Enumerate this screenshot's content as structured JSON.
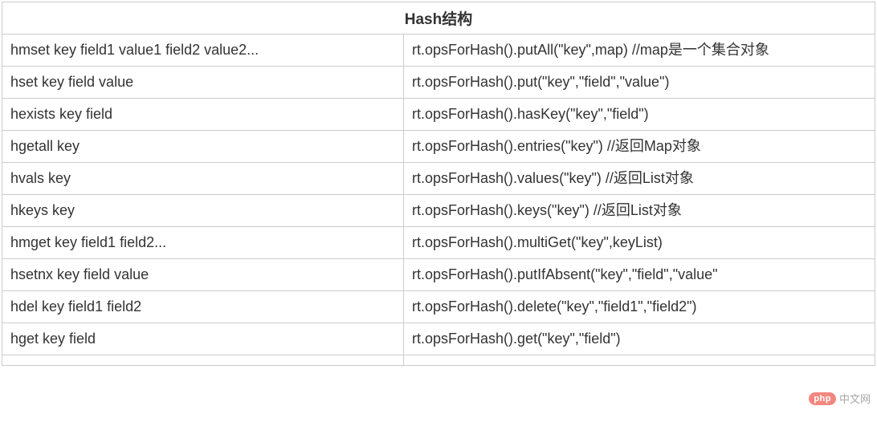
{
  "table": {
    "header": "Hash结构",
    "rows": [
      {
        "left": "hmset key field1 value1 field2 value2...",
        "right": "rt.opsForHash().putAll(\"key\",map) //map是一个集合对象"
      },
      {
        "left": "hset key field value",
        "right": "rt.opsForHash().put(\"key\",\"field\",\"value\")"
      },
      {
        "left": "hexists key field",
        "right": "rt.opsForHash().hasKey(\"key\",\"field\")"
      },
      {
        "left": "hgetall key",
        "right": "rt.opsForHash().entries(\"key\")  //返回Map对象"
      },
      {
        "left": "hvals key",
        "right": "rt.opsForHash().values(\"key\") //返回List对象"
      },
      {
        "left": "hkeys key",
        "right": "rt.opsForHash().keys(\"key\") //返回List对象"
      },
      {
        "left": "hmget key field1 field2...",
        "right": "rt.opsForHash().multiGet(\"key\",keyList)"
      },
      {
        "left": "hsetnx key field value",
        "right": "rt.opsForHash().putIfAbsent(\"key\",\"field\",\"value\""
      },
      {
        "left": "hdel key field1 field2",
        "right": "rt.opsForHash().delete(\"key\",\"field1\",\"field2\")"
      },
      {
        "left": "hget key field",
        "right": "rt.opsForHash().get(\"key\",\"field\")"
      },
      {
        "left": "",
        "right": ""
      }
    ]
  },
  "watermark": {
    "badge": "php",
    "text": "中文网"
  }
}
